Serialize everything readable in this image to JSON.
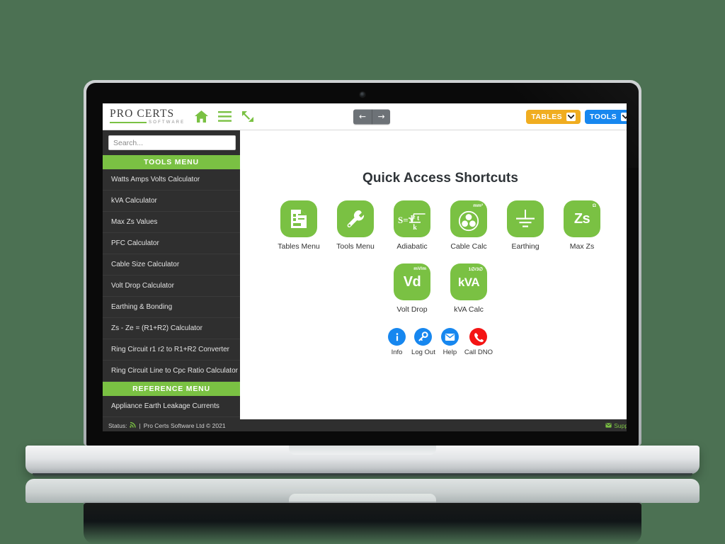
{
  "brand": {
    "name_top": "PRO CERTS",
    "name_sub": "SOFTWARE"
  },
  "topbar": {
    "home_icon": "home-icon",
    "menu_icon": "hamburger-icon",
    "expand_icon": "expand-arrows-icon",
    "back_label": "←",
    "forward_label": "→",
    "tables_label": "TABLES",
    "tools_label": "TOOLS",
    "tables_color": "#f0ad20",
    "tools_color": "#1787ef"
  },
  "sidebar": {
    "search_placeholder": "Search...",
    "search_value": "",
    "tools_menu_header": "TOOLS MENU",
    "tools_items": [
      "Watts Amps Volts Calculator",
      "kVA Calculator",
      "Max Zs Values",
      "PFC Calculator",
      "Cable Size Calculator",
      "Volt Drop Calculator",
      "Earthing & Bonding",
      "Zs - Ze = (R1+R2) Calculator",
      "Ring Circuit r1 r2 to R1+R2 Converter",
      "Ring Circuit Line to Cpc Ratio Calculator"
    ],
    "reference_menu_header": "REFERENCE MENU",
    "reference_items": [
      "Appliance Earth Leakage Currents"
    ]
  },
  "content": {
    "title": "Quick Access Shortcuts",
    "row1": [
      {
        "label": "Tables Menu",
        "icon": "document-table-icon",
        "sup": ""
      },
      {
        "label": "Tools Menu",
        "icon": "wrench-icon",
        "sup": ""
      },
      {
        "label": "Adiabatic",
        "icon": "adiabatic-formula-icon",
        "sup": ""
      },
      {
        "label": "Cable Calc",
        "icon": "cable-cross-section-icon",
        "sup": "mm²"
      },
      {
        "label": "Earthing",
        "icon": "earth-ground-icon",
        "sup": ""
      },
      {
        "label": "Max Zs",
        "icon": "zs-text-icon",
        "sup": "Ω",
        "text": "Zs"
      }
    ],
    "row2": [
      {
        "label": "Volt Drop",
        "icon": "volt-drop-icon",
        "sup": "mV/m",
        "text": "Vd"
      },
      {
        "label": "kVA Calc",
        "icon": "kva-icon",
        "sup": "1∅/3∅",
        "text": "kVA"
      }
    ],
    "mini_row": [
      {
        "label": "Info",
        "icon": "info-icon",
        "glyph": "i",
        "color": "#1787ef"
      },
      {
        "label": "Log Out",
        "icon": "key-icon",
        "glyph": "key",
        "color": "#1787ef"
      },
      {
        "label": "Help",
        "icon": "envelope-icon",
        "glyph": "envelope",
        "color": "#1787ef"
      },
      {
        "label": "Call DNO",
        "icon": "phone-icon",
        "glyph": "phone",
        "color": "#f41414"
      }
    ],
    "adiabatic": {
      "lhs": "S=",
      "numerator": "I² t",
      "denominator": "k"
    }
  },
  "statusbar": {
    "status_label": "Status:",
    "status_icon": "signal-icon",
    "separator": "|",
    "copyright": "Pro Certs Software Ltd © 2021",
    "support_label": "Support",
    "support_icon": "mail-icon"
  },
  "colors": {
    "accent_green": "#7ac143",
    "background": "#4c7153",
    "sidebar_bg": "#2f2f2f"
  }
}
